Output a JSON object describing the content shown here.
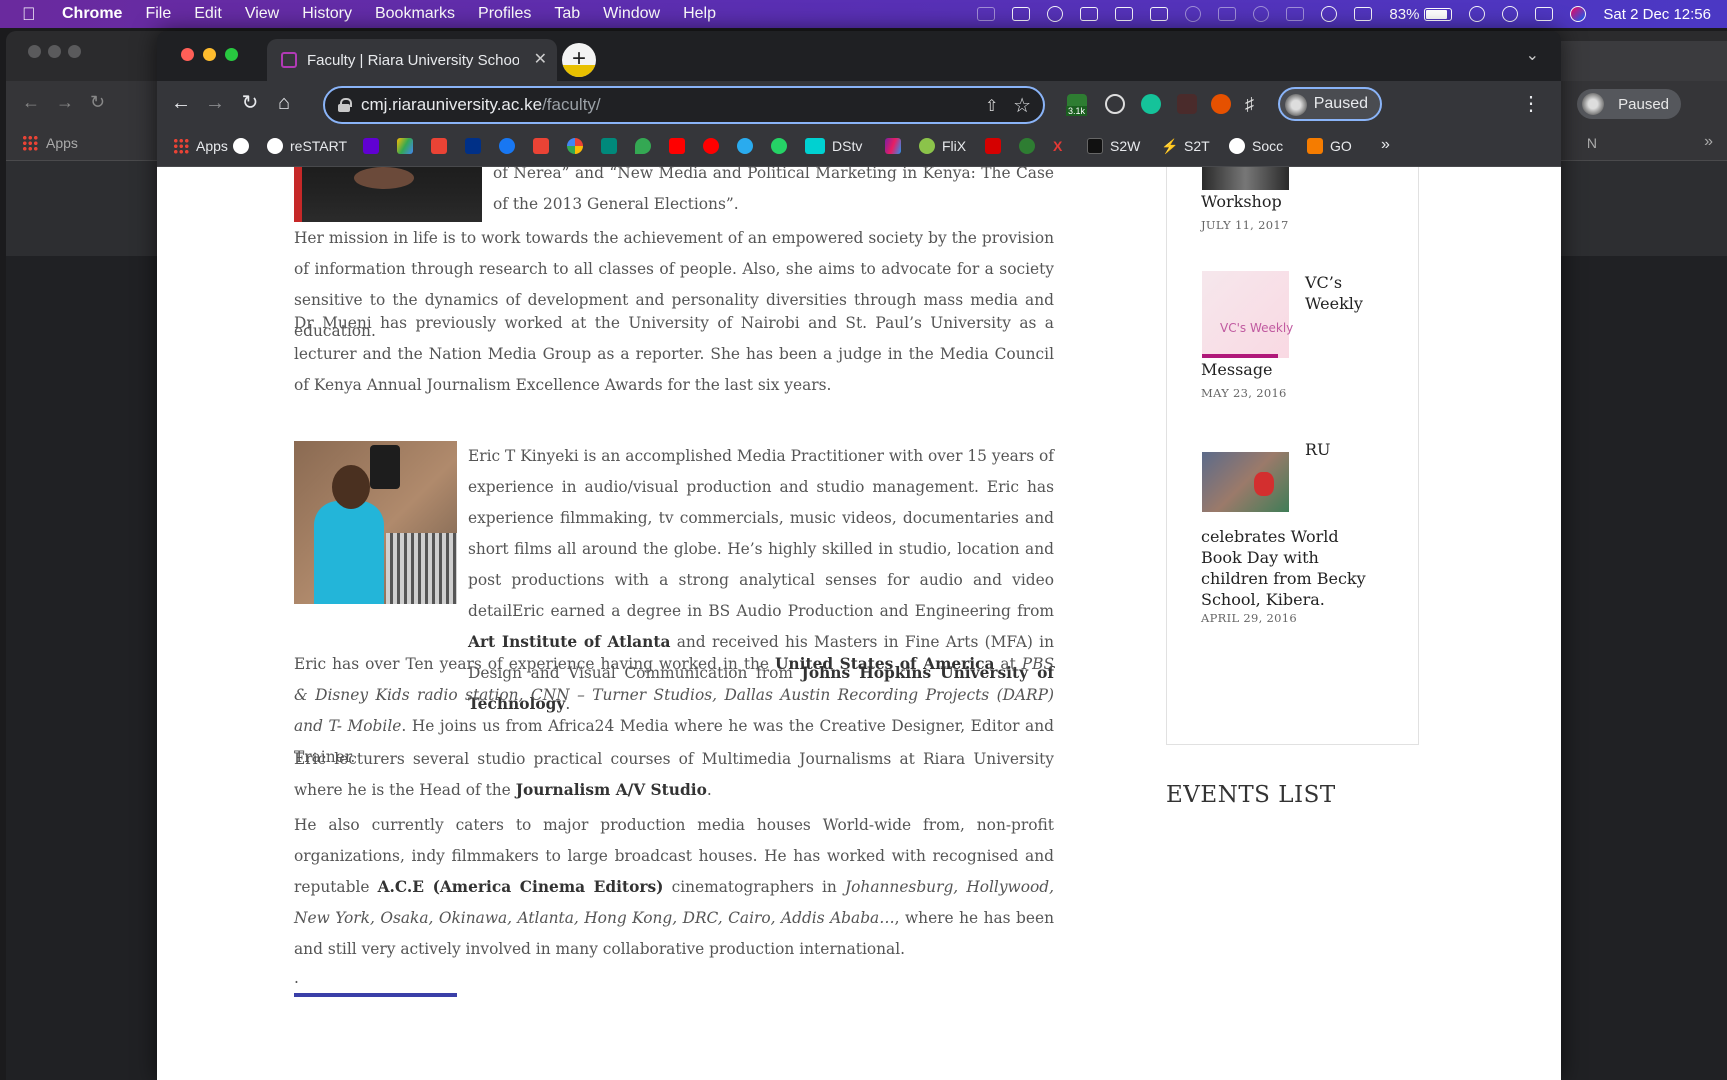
{
  "menubar": {
    "app": "Chrome",
    "items": [
      "File",
      "Edit",
      "View",
      "History",
      "Bookmarks",
      "Profiles",
      "Tab",
      "Window",
      "Help"
    ],
    "battery": "83%",
    "datetime": "Sat 2 Dec  12:56"
  },
  "background_window": {
    "bookmarks": {
      "apps": "Apps",
      "trailing": "N"
    },
    "profile_label": "Paused"
  },
  "browser": {
    "tab_title": "Faculty | Riara University School",
    "url_host": "cmj.riarauniversity.ac.ke",
    "url_path": "/faculty/",
    "extension_badge": "3.1k",
    "profile_label": "Paused",
    "bookmarks": [
      "Apps",
      "reSTART",
      "DStv",
      "FliX",
      "S2W",
      "S2T",
      "Socc",
      "GO"
    ]
  },
  "article": {
    "top_text": "of Nerea” and “New Media and Political Marketing in Kenya: The Case of the 2013 General Elections”.",
    "para_mission": "Her mission in life is to work towards the achievement of an empowered society by the provision of information through research to all classes of people. Also, she aims to advocate for a society sensitive to the dynamics of development and personality diversities through mass media and education.",
    "para_mueni": "Dr Mueni has previously worked at the University of Nairobi and St. Paul’s University as a lecturer and the Nation Media Group as a reporter. She has been a judge in the Media Council of Kenya Annual Journalism Excellence Awards for the last six years.",
    "eric": {
      "p1_a": "Eric T Kinyeki is an accomplished Media Practitioner with over 15 years of experience in audio/visual production and studio management. Eric has experience  filmmaking, tv commercials, music videos, documentaries and short films all around the globe. He’s highly skilled in studio, location and post productions with a strong analytical senses for audio and video detailEric earned a degree in BS Audio Production and Engineering from ",
      "p1_b1": "Art Institute of Atlanta",
      "p1_c": " and received his Masters in Fine Arts (MFA) in Design and Visual Communication from ",
      "p1_b2": "Johns Hopkins University of Technology",
      "p1_d": ".",
      "p2_a": "Eric has over Ten years of experience having worked in the ",
      "p2_b": "United States of America",
      "p2_c": " at ",
      "p2_i": "PBS & Disney Kids radio station, CNN – Turner Studios, Dallas Austin Recording Projects (DARP) and T- Mobile",
      "p2_d": ". He joins us from Africa24 Media where he was the Creative Designer, Editor and Trainer.",
      "p3_a": "Eric lecturers several studio practical courses of Multimedia Journalisms at Riara University where he is the Head of the ",
      "p3_b": "Journalism A/V Studio",
      "p3_c": ".",
      "p4_a": "He also currently caters to major production media houses World-wide from, non-profit organizations, indy filmmakers to large broadcast houses. He has worked with recognised and reputable ",
      "p4_b": "A.C.E (America Cinema Editors)",
      "p4_c": " cinematographers in ",
      "p4_i": "Johannesburg, Hollywood, New York, Osaka, Okinawa, Atlanta, Hong Kong, DRC, Cairo, Addis Ababa…",
      "p4_d": ", where he has been and still very actively involved in many collaborative production international."
    },
    "trailing_dot": "."
  },
  "sidebar": {
    "posts": [
      {
        "title": "Workshop",
        "date": "JULY 11, 2017"
      },
      {
        "title_side": "VC’s Weekly",
        "title_below": "Message",
        "thumb_text": "VC's Weekly",
        "date": "MAY 23, 2016"
      },
      {
        "title_side": "RU",
        "title_below": "celebrates World Book Day with children from Becky School, Kibera.",
        "date": "APRIL 29, 2016"
      }
    ],
    "events_heading": "EVENTS LIST"
  },
  "colors": {
    "accent": "#8ab4f8",
    "menubar": "#5a2fb3",
    "page_text": "#555555"
  }
}
